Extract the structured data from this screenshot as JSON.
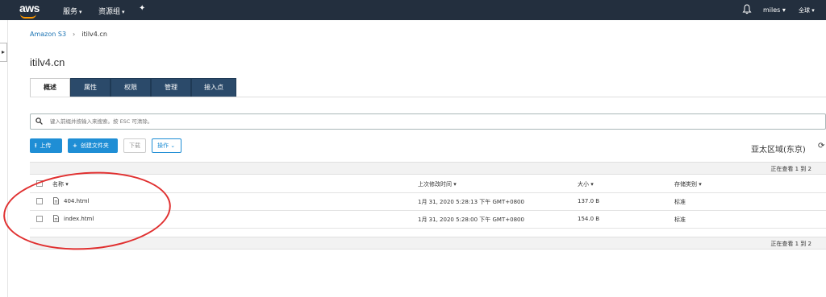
{
  "topbar": {
    "logo": "aws",
    "services": "服务",
    "resource_groups": "资源组",
    "pin_icon": "pin-icon",
    "bell_icon": "bell-icon",
    "user": "miles",
    "region": "全球"
  },
  "breadcrumb": {
    "root": "Amazon S3",
    "separator": "›",
    "current": "itilv4.cn"
  },
  "bucket": {
    "title": "itilv4.cn"
  },
  "tabs": [
    {
      "label": "概述",
      "active": true
    },
    {
      "label": "属性",
      "active": false
    },
    {
      "label": "权限",
      "active": false
    },
    {
      "label": "管理",
      "active": false
    },
    {
      "label": "接入点",
      "active": false
    }
  ],
  "search": {
    "placeholder": "键入前缀并按输入来搜索。按 ESC 可清除。"
  },
  "actions": {
    "upload": "上传",
    "create_folder": "创建文件夹",
    "download": "下载",
    "operations": "操作",
    "region": "亚太区域(东京)"
  },
  "viewing": "正在查看 1 到 2",
  "table": {
    "columns": [
      "名称",
      "上次修改时间",
      "大小",
      "存储类别"
    ],
    "rows": [
      {
        "name": "404.html",
        "modified": "1月 31, 2020 5:28:13 下午 GMT+0800",
        "size": "137.0 B",
        "storage": "标准"
      },
      {
        "name": "index.html",
        "modified": "1月 31, 2020 5:28:00 下午 GMT+0800",
        "size": "154.0 B",
        "storage": "标准"
      }
    ]
  },
  "colors": {
    "topbar": "#232f3e",
    "tab": "#2b4a6a",
    "primary": "#1f8ed5",
    "link": "#1b73b3",
    "annotation": "#e03030"
  }
}
